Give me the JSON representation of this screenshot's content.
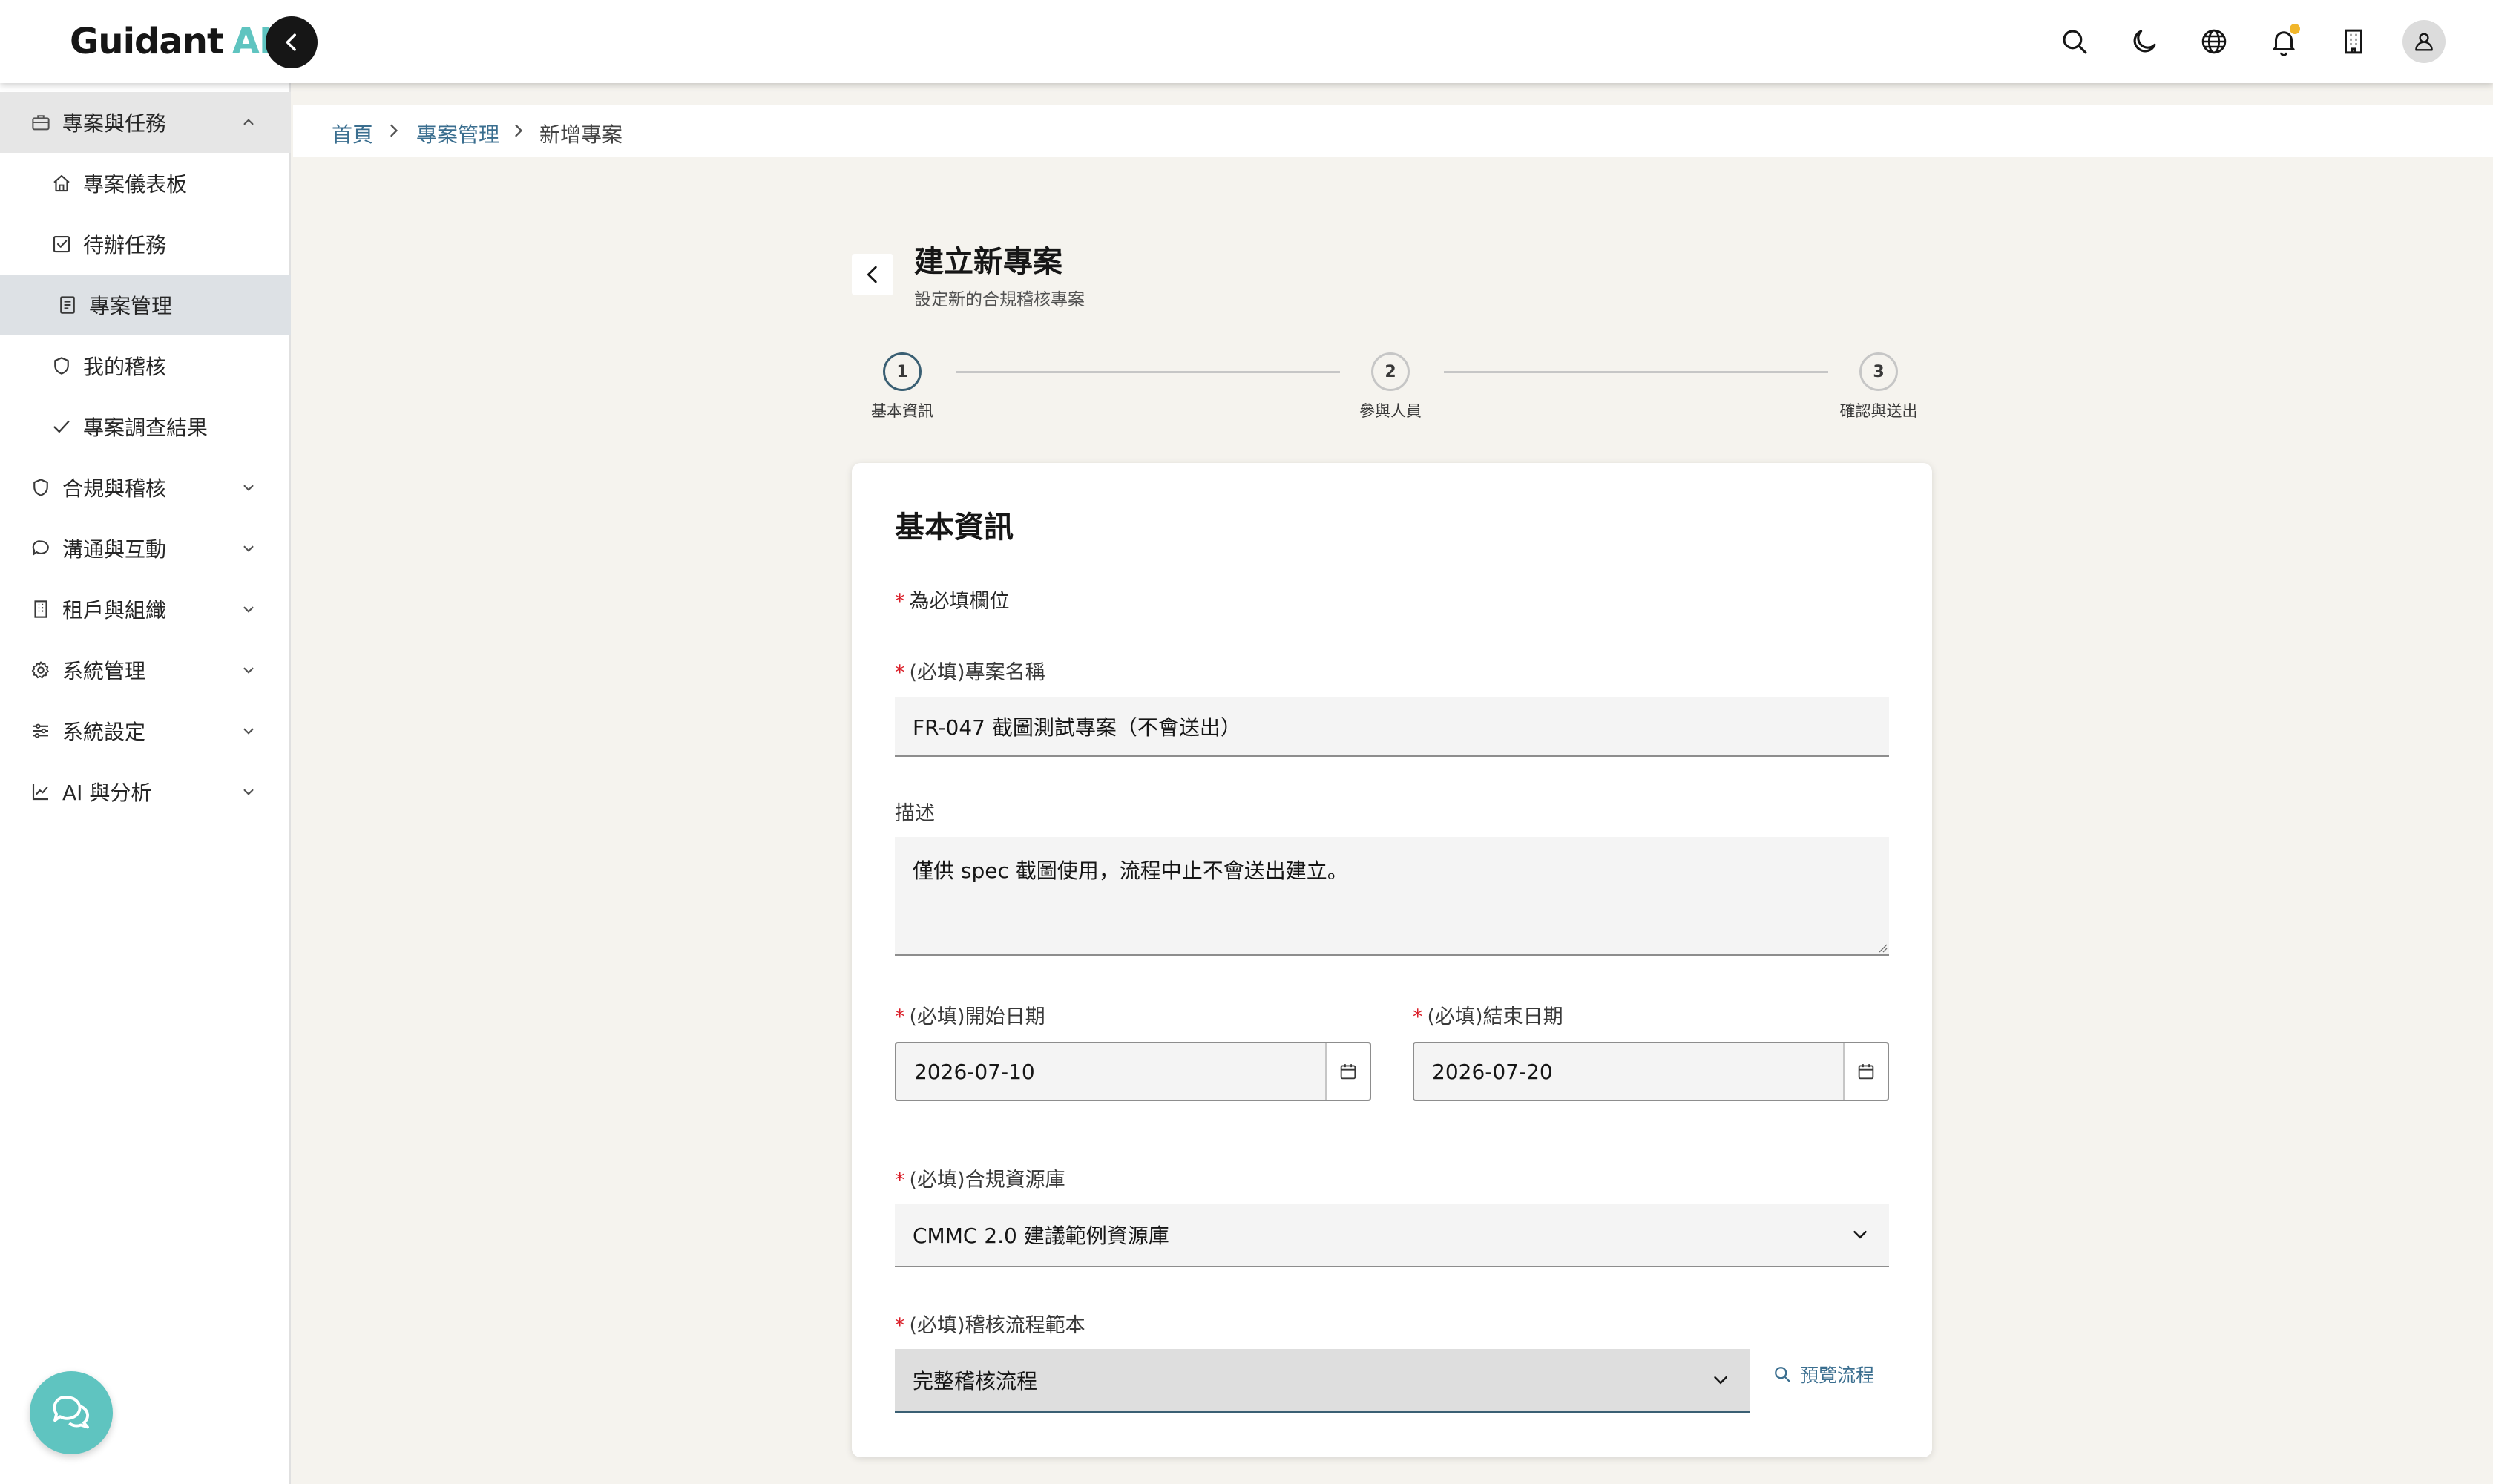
{
  "header": {
    "logo_main": "Guidant",
    "logo_ai": "AI",
    "icons": [
      "search-icon",
      "moon-icon",
      "globe-icon",
      "bell-icon",
      "building-icon",
      "user-icon"
    ],
    "accent_color": "#5fc4c0",
    "notification_dot_color": "#f1b62a"
  },
  "sidebar": {
    "items": [
      {
        "label": "專案與任務",
        "icon": "briefcase-icon",
        "type": "parent",
        "expanded": true
      },
      {
        "label": "專案儀表板",
        "icon": "home-icon",
        "type": "child"
      },
      {
        "label": "待辦任務",
        "icon": "checkbox-icon",
        "type": "child"
      },
      {
        "label": "專案管理",
        "icon": "document-icon",
        "type": "child",
        "active": true
      },
      {
        "label": "我的稽核",
        "icon": "shield-icon",
        "type": "child"
      },
      {
        "label": "專案調查結果",
        "icon": "check-icon",
        "type": "child"
      },
      {
        "label": "合規與稽核",
        "icon": "shield-icon",
        "type": "parent"
      },
      {
        "label": "溝通與互動",
        "icon": "chat-icon",
        "type": "parent"
      },
      {
        "label": "租戶與組織",
        "icon": "building-icon",
        "type": "parent"
      },
      {
        "label": "系統管理",
        "icon": "gear-icon",
        "type": "parent"
      },
      {
        "label": "系統設定",
        "icon": "sliders-icon",
        "type": "parent"
      },
      {
        "label": "AI 與分析",
        "icon": "chart-line-icon",
        "type": "parent"
      }
    ]
  },
  "breadcrumb": {
    "home": "首頁",
    "section": "專案管理",
    "current": "新增專案"
  },
  "page": {
    "title": "建立新專案",
    "subtitle": "設定新的合規稽核專案"
  },
  "stepper": {
    "steps": [
      {
        "number": "1",
        "label": "基本資訊",
        "active": true
      },
      {
        "number": "2",
        "label": "參與人員",
        "active": false
      },
      {
        "number": "3",
        "label": "確認與送出",
        "active": false
      }
    ]
  },
  "form": {
    "section_title": "基本資訊",
    "required_star": "*",
    "required_note": "為必填欄位",
    "name_label": "(必填)專案名稱",
    "name_value": "FR-047 截圖測試專案（不會送出）",
    "description_label": "描述",
    "description_value": "僅供 spec 截圖使用，流程中止不會送出建立。",
    "start_date_label": "(必填)開始日期",
    "start_date_value": "2026-07-10",
    "end_date_label": "(必填)結束日期",
    "end_date_value": "2026-07-20",
    "library_label": "(必填)合規資源庫",
    "library_value": "CMMC 2.0 建議範例資源庫",
    "template_label": "(必填)稽核流程範本",
    "template_value": "完整稽核流程",
    "preview_label": "預覽流程"
  }
}
